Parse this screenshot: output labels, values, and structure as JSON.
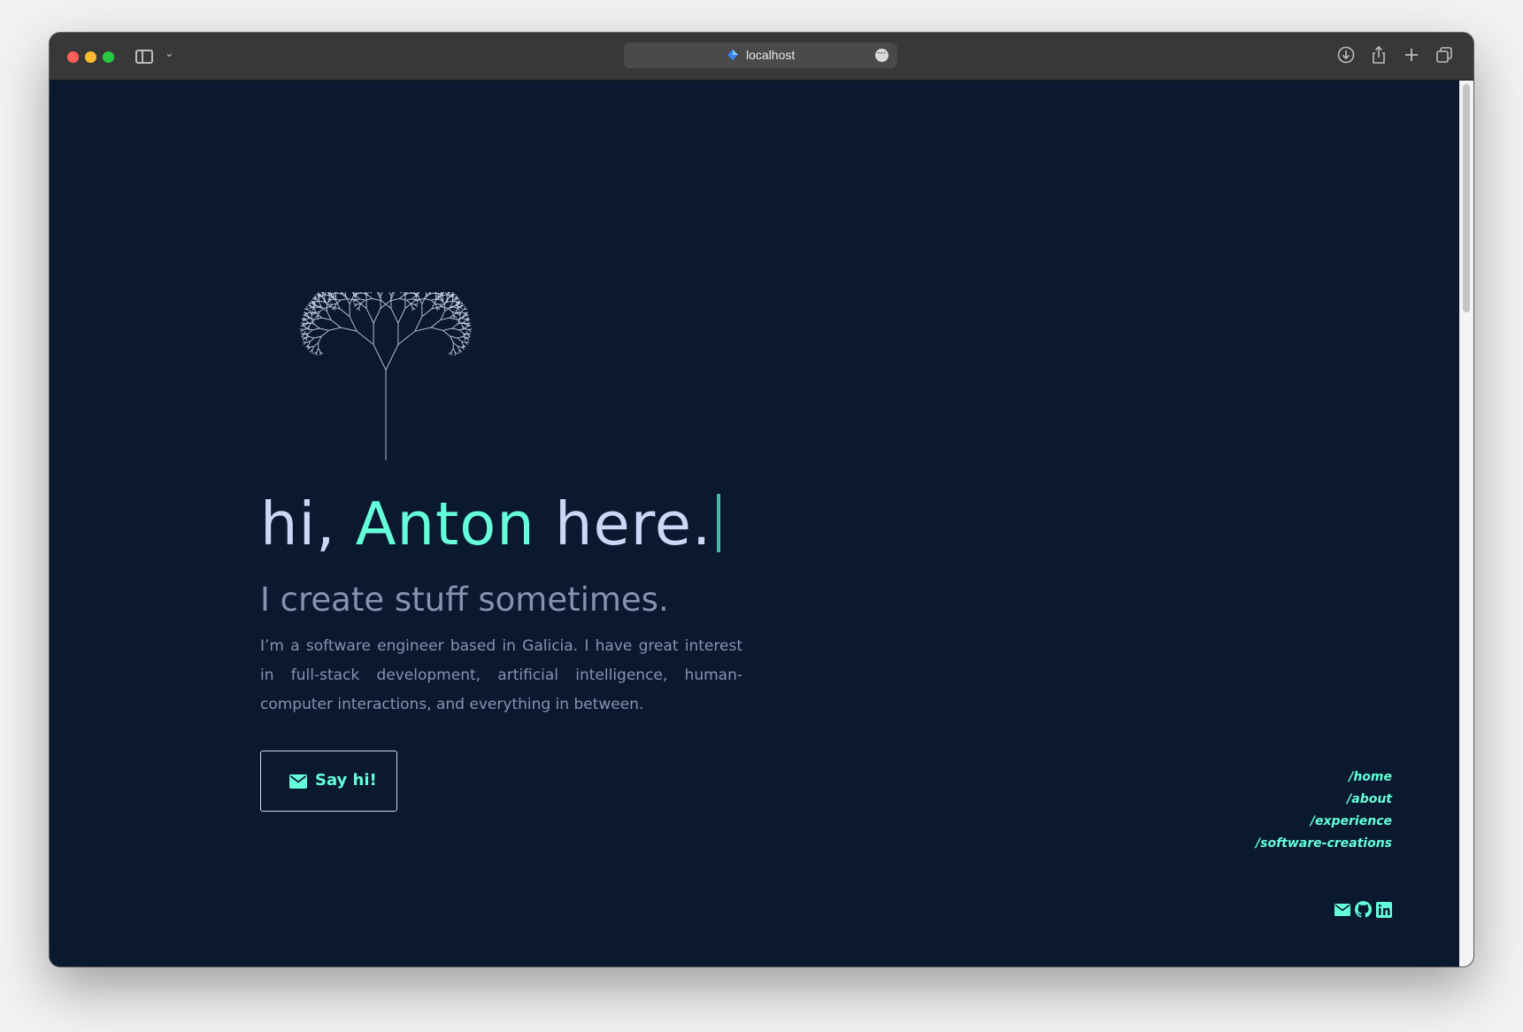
{
  "browser": {
    "url": "localhost"
  },
  "hero": {
    "greeting": "hi, ",
    "name": "Anton",
    "greeting_end": " here.",
    "subtitle": "I create stuff sometimes.",
    "intro": "I’m a software engineer based in Galicia. I have great interest in full-stack development, artificial intelligence, human-computer interactions, and everything in between.",
    "cta_label": "Say hi!"
  },
  "nav": {
    "items": [
      "/home",
      "/about",
      "/experience",
      "/software-creations"
    ]
  },
  "socials": [
    "mail-icon",
    "github-icon",
    "linkedin-icon"
  ],
  "colors": {
    "background": "#0a192f",
    "accent": "#64ffda",
    "heading": "#ccd6f6",
    "body_text": "#8892b0"
  }
}
